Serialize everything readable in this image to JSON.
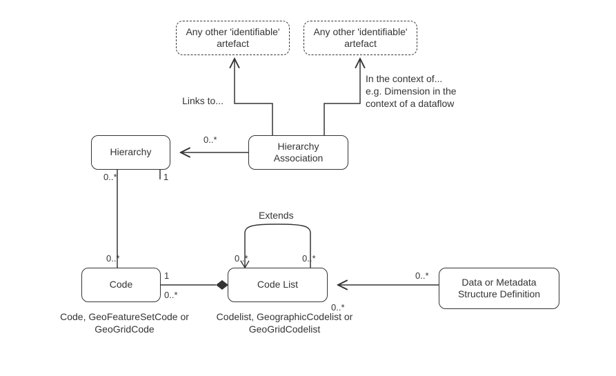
{
  "nodes": {
    "artefact1": "Any other\n'identifiable' artefact",
    "artefact2": "Any other\n'identifiable' artefact",
    "hierarchy": "Hierarchy",
    "hierarchyAssoc": "Hierarchy\nAssociation",
    "code": "Code",
    "codelist": "Code List",
    "structDef": "Data or Metadata\nStructure Definition"
  },
  "labels": {
    "linksTo": "Links to...",
    "contextNote": "In the context of...\ne.g. Dimension in the\ncontext of a dataflow",
    "extends": "Extends",
    "codeCaption": "Code, GeoFeatureSetCode or\nGeoGridCode",
    "codelistCaption": "Codelist, GeographicCodelist or\nGeoGridCodelist"
  },
  "mult": {
    "hierarchy_codeTop": "0..*",
    "hierarchy_codeBottom": "0..*",
    "hierarchy_side": "1",
    "assoc_to_hier": "0..*",
    "code_one": "1",
    "code_many": "0..*",
    "extends_left": "0..*",
    "extends_right": "0..*",
    "codelist_right": "0..*",
    "structDef_left": "0..*"
  }
}
